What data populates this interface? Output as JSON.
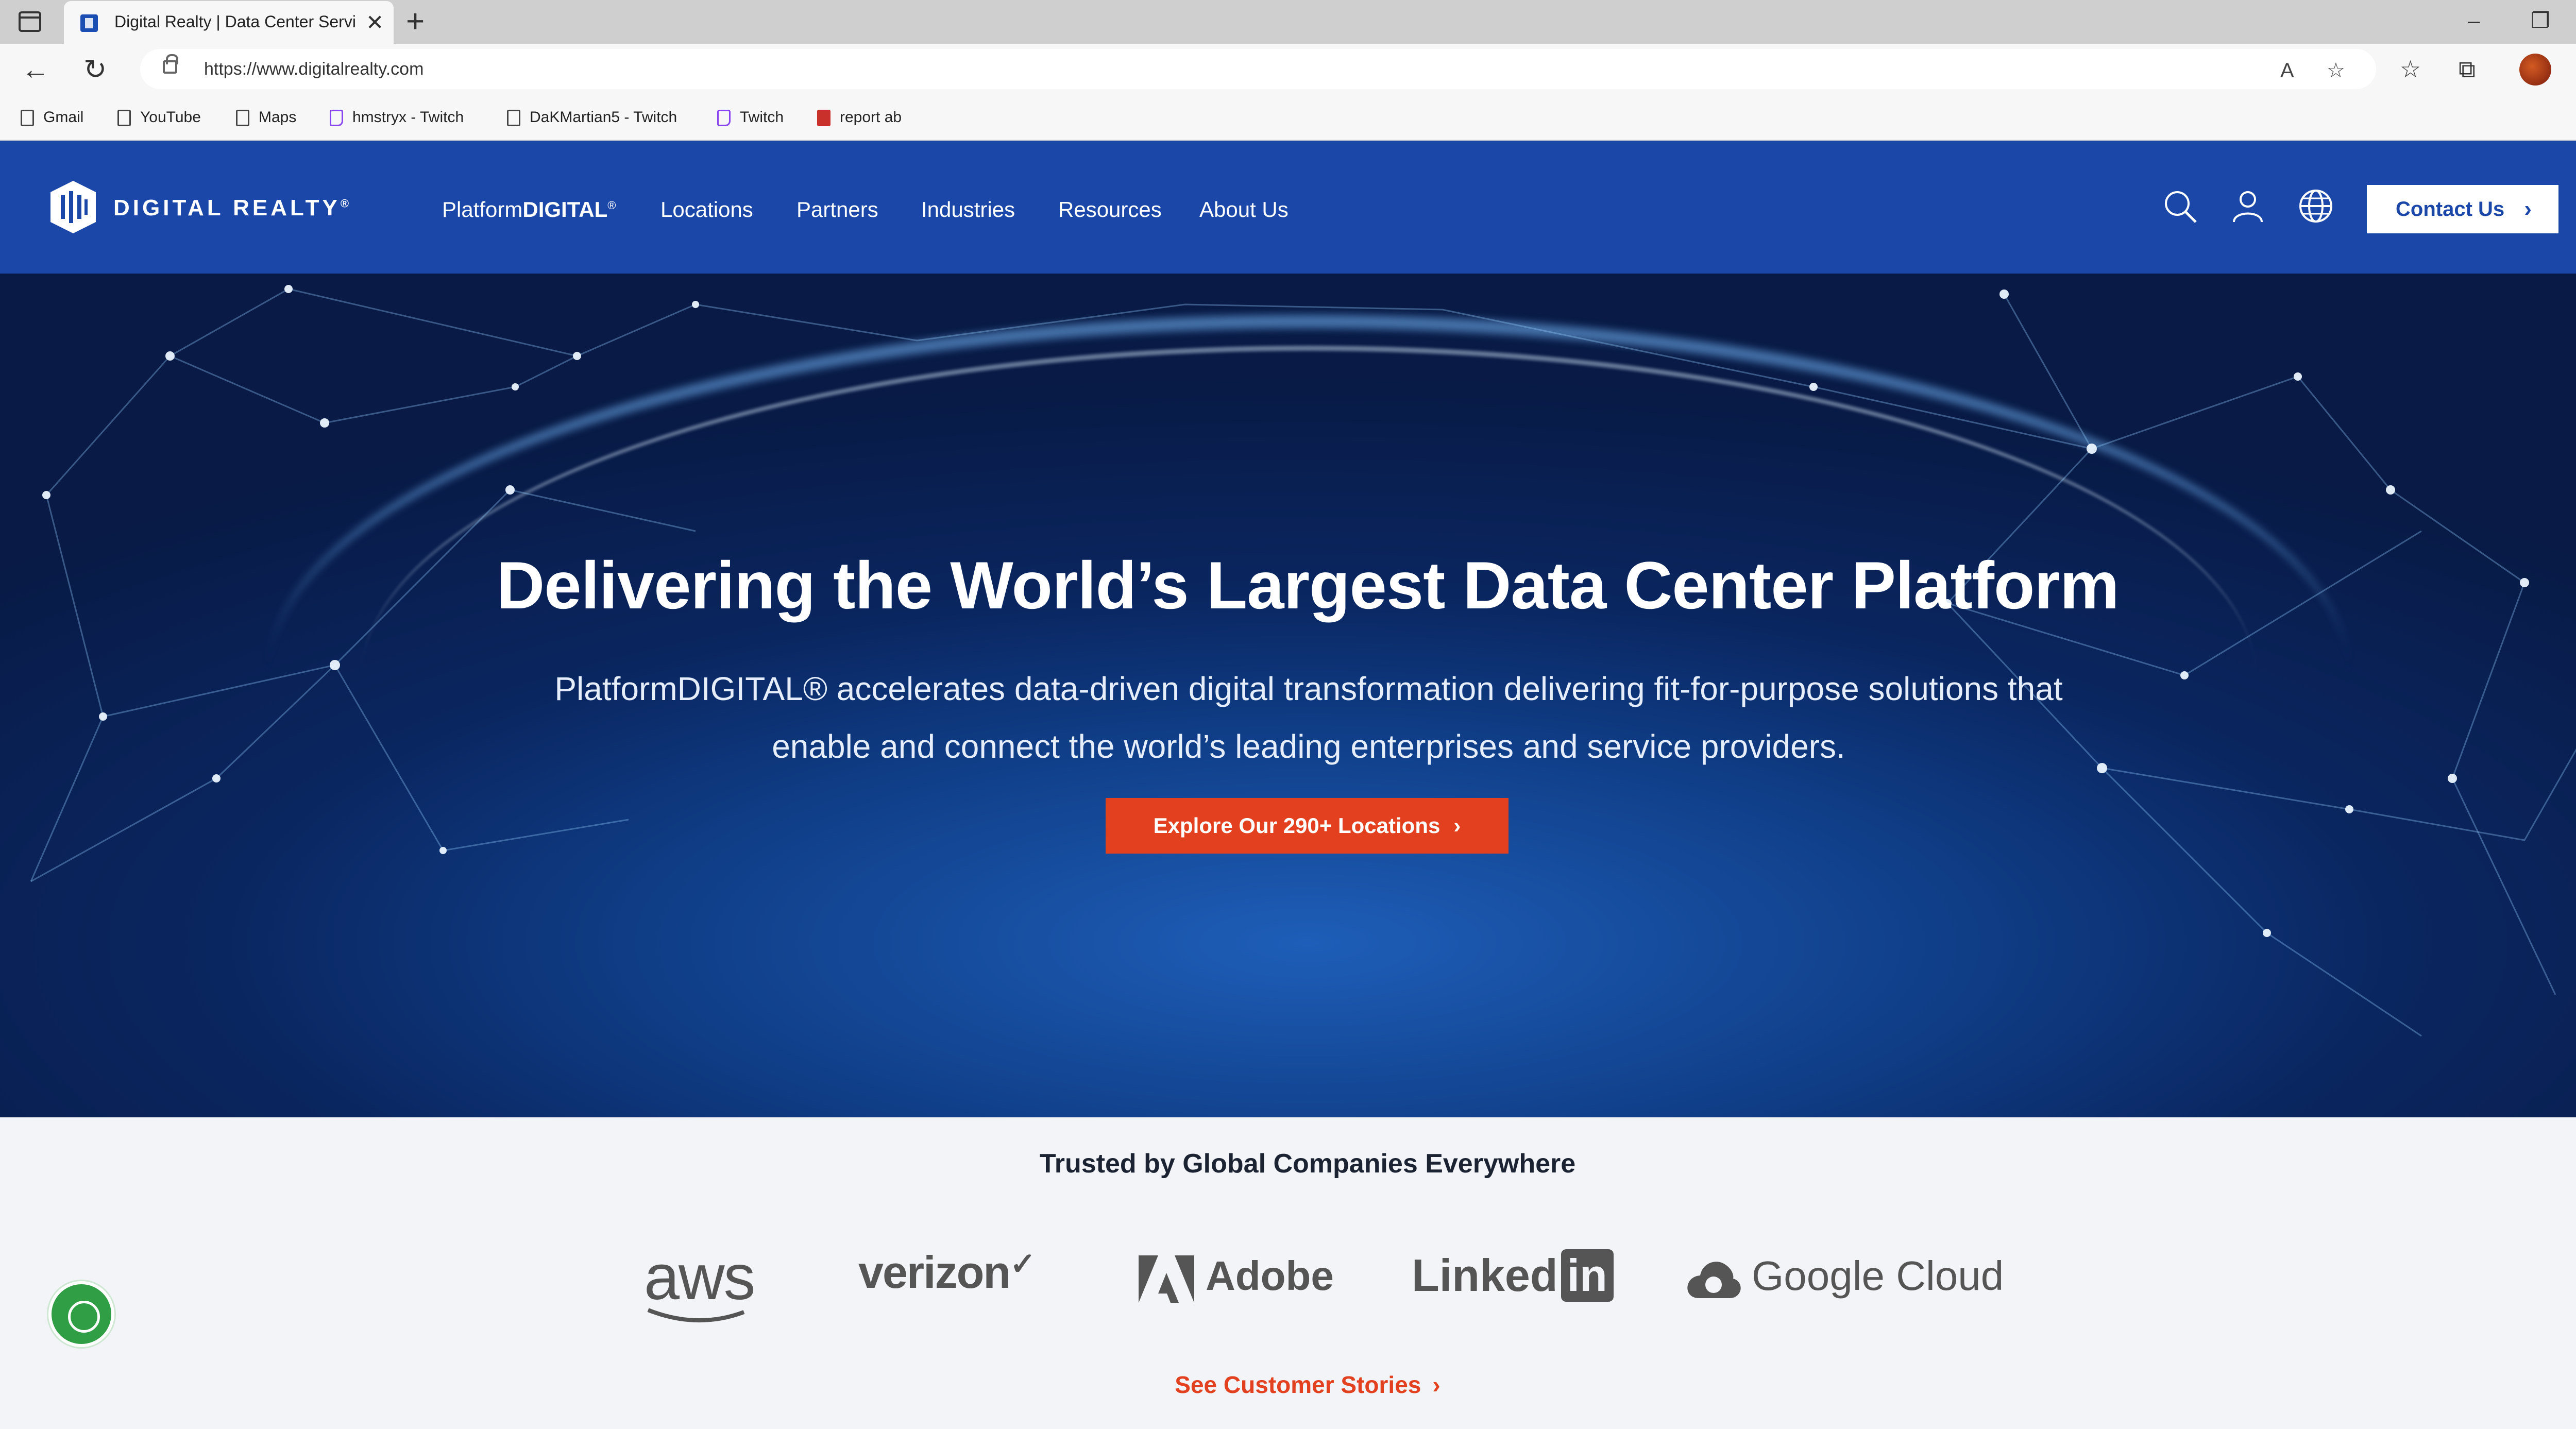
{
  "browser": {
    "tab_title": "Digital Realty | Data Center Servi",
    "url": "https://www.digitalrealty.com",
    "bookmarks": [
      {
        "label": "Gmail",
        "icon": "page-icon"
      },
      {
        "label": "YouTube",
        "icon": "page-icon"
      },
      {
        "label": "Maps",
        "icon": "page-icon"
      },
      {
        "label": "hmstryx - Twitch",
        "icon": "twitch-icon"
      },
      {
        "label": "DaKMartian5 - Twitch",
        "icon": "page-icon"
      },
      {
        "label": "Twitch",
        "icon": "twitch-icon"
      },
      {
        "label": "report ab",
        "icon": "pdf-icon"
      }
    ]
  },
  "header": {
    "logo_text": "DIGITAL REALTY",
    "logo_reg": "®",
    "nav": {
      "platform_prefix": "Platform",
      "platform_strong": "DIGITAL",
      "platform_reg": "®",
      "locations": "Locations",
      "partners": "Partners",
      "industries": "Industries",
      "resources": "Resources",
      "about": "About Us"
    },
    "contact_label": "Contact Us"
  },
  "hero": {
    "title": "Delivering the World’s Largest Data Center Platform",
    "subtitle": "PlatformDIGITAL® accelerates data-driven digital transformation delivering fit-for-purpose solutions that enable and connect the world’s leading enterprises and service providers.",
    "cta_label": "Explore Our 290+ Locations"
  },
  "trusted": {
    "title": "Trusted by Global Companies Everywhere",
    "logos": [
      "aws",
      "verizon",
      "Adobe",
      "Linked",
      "in",
      "Google Cloud"
    ],
    "stories_label": "See Customer Stories"
  },
  "colors": {
    "brand_blue": "#1a47a8",
    "accent_orange": "#e2401f"
  }
}
